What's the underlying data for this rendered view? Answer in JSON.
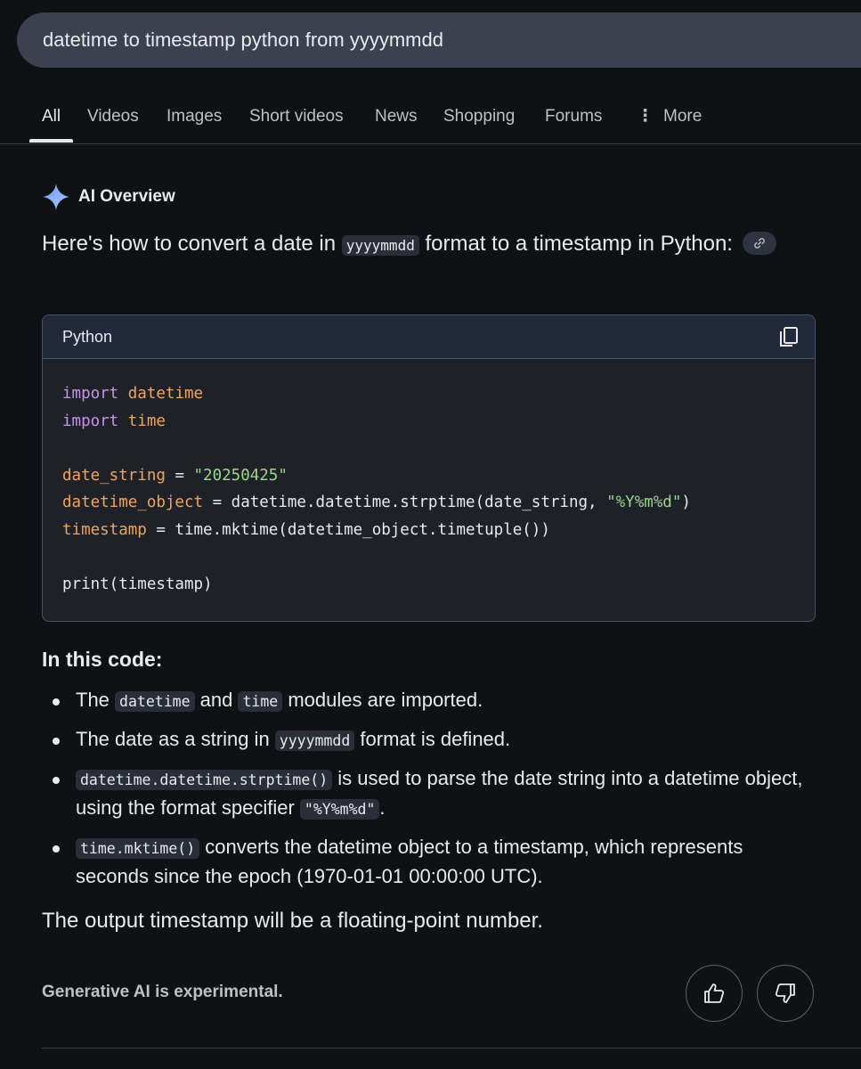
{
  "search": {
    "query": "datetime to timestamp python from yyyymmdd"
  },
  "tabs": [
    {
      "label": "All",
      "active": true
    },
    {
      "label": "Videos"
    },
    {
      "label": "Images"
    },
    {
      "label": "Short videos"
    },
    {
      "label": "News"
    },
    {
      "label": "Shopping"
    },
    {
      "label": "Forums"
    },
    {
      "label": "More"
    }
  ],
  "ai_overview": {
    "title": "AI Overview",
    "intro_before": "Here's how to convert a date in ",
    "intro_code": "yyyymmdd",
    "intro_after": " format to a timestamp in Python:",
    "code_block": {
      "language": "Python",
      "lines": {
        "l1_kw": "import",
        "l1_id": "datetime",
        "l2_kw": "import",
        "l2_id": "time",
        "l4_id": "date_string",
        "l4_op": " = ",
        "l4_str": "\"20250425\"",
        "l5_id": "datetime_object",
        "l5_op": " = datetime.datetime.strptime(date_string, ",
        "l5_str": "\"%Y%m%d\"",
        "l5_end": ")",
        "l6_id": "timestamp",
        "l6_op": " = time.mktime(datetime_object.timetuple())",
        "l8": "print(timestamp)"
      }
    },
    "sub_heading": "In this code:",
    "bullets": {
      "b1_pre": "The ",
      "b1_code1": "datetime",
      "b1_mid": " and ",
      "b1_code2": "time",
      "b1_post": " modules are imported.",
      "b2_pre": "The date as a string in ",
      "b2_code": "yyyymmdd",
      "b2_post": " format is defined.",
      "b3_code": "datetime.datetime.strptime()",
      "b3_mid": " is used to parse the date string into a datetime object, using the format specifier ",
      "b3_code2": "\"%Y%m%d\"",
      "b3_post": ".",
      "b4_code": "time.mktime()",
      "b4_post": " converts the datetime object to a timestamp, which represents seconds since the epoch (1970-01-01 00:00:00 UTC)."
    },
    "outro": "The output timestamp will be a floating-point number.",
    "disclaimer": "Generative AI is experimental."
  },
  "icons": {
    "sparkle": "sparkle-icon",
    "link": "link-icon",
    "copy": "copy-icon",
    "thumbs_up": "thumbs-up-icon",
    "thumbs_down": "thumbs-down-icon",
    "more": "more-vertical-icon"
  },
  "colors": {
    "background": "#101114",
    "search_bg": "#3c4150",
    "keyword": "#c792ea",
    "identifier": "#f0a45d",
    "string": "#9bd68b",
    "sparkle": "#8ab4f8"
  }
}
